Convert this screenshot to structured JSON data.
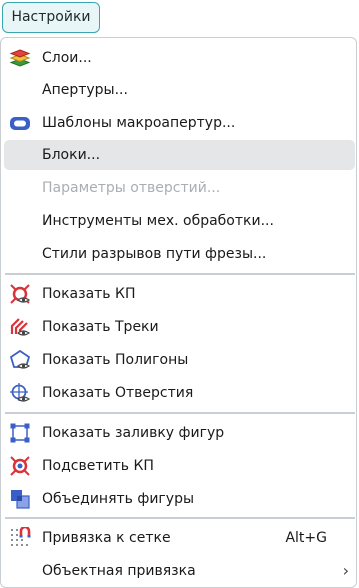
{
  "button": {
    "label": "Настройки"
  },
  "menu": {
    "items": [
      {
        "label": "Слои...",
        "icon": "layers-icon"
      },
      {
        "label": "Апертуры...",
        "icon": ""
      },
      {
        "label": "Шаблоны макроапертур...",
        "icon": "macro-aperture-icon"
      },
      {
        "label": "Блоки...",
        "icon": "",
        "highlighted": true
      },
      {
        "label": "Параметры отверстий...",
        "icon": "",
        "disabled": true
      },
      {
        "label": "Инструменты мех. обработки...",
        "icon": ""
      },
      {
        "label": "Стили разрывов пути фрезы...",
        "icon": ""
      },
      {
        "label": "Показать КП",
        "icon": "show-pads-icon"
      },
      {
        "label": "Показать Треки",
        "icon": "show-tracks-icon"
      },
      {
        "label": "Показать Полигоны",
        "icon": "show-polygons-icon"
      },
      {
        "label": "Показать Отверстия",
        "icon": "show-holes-icon"
      },
      {
        "label": "Показать заливку фигур",
        "icon": "shape-fill-icon"
      },
      {
        "label": "Подсветить КП",
        "icon": "highlight-pads-icon"
      },
      {
        "label": "Объединять фигуры",
        "icon": "merge-shapes-icon"
      },
      {
        "label": "Привязка к сетке",
        "icon": "grid-snap-icon",
        "shortcut": "Alt+G"
      },
      {
        "label": "Объектная привязка",
        "icon": "",
        "submenu": true
      }
    ]
  },
  "colors": {
    "accent": "#3aa6b0",
    "highlight": "#e4e6e8",
    "icon_red": "#d9343a",
    "icon_blue": "#3a60c8"
  }
}
